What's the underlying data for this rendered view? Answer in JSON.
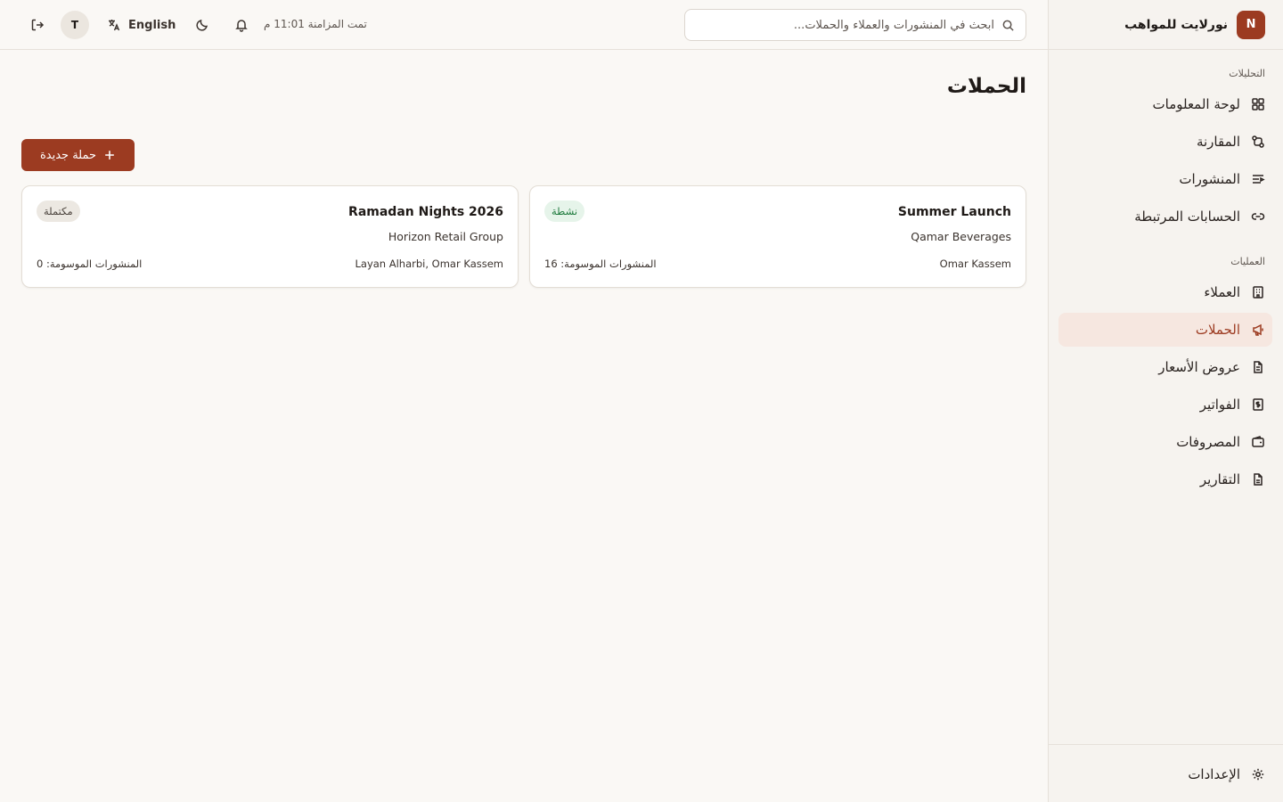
{
  "brand": {
    "initial": "N",
    "name": "نورلايت للمواهب"
  },
  "search": {
    "placeholder": "ابحث في المنشورات والعملاء والحملات..."
  },
  "topbar": {
    "sync_status": "تمت المزامنة 11:01 م",
    "language_label": "English",
    "avatar_initial": "T"
  },
  "sidebar": {
    "analytics_title": "التحليلات",
    "analytics_items": [
      {
        "label": "لوحة المعلومات",
        "icon": "dashboard-icon"
      },
      {
        "label": "المقارنة",
        "icon": "compare-icon"
      },
      {
        "label": "المنشورات",
        "icon": "posts-icon"
      },
      {
        "label": "الحسابات المرتبطة",
        "icon": "link-icon"
      }
    ],
    "operations_title": "العمليات",
    "operations_items": [
      {
        "label": "العملاء",
        "icon": "building-icon"
      },
      {
        "label": "الحملات",
        "icon": "megaphone-icon",
        "active": true
      },
      {
        "label": "عروض الأسعار",
        "icon": "document-icon"
      },
      {
        "label": "الفواتير",
        "icon": "dollar-receipt-icon"
      },
      {
        "label": "المصروفات",
        "icon": "wallet-icon"
      },
      {
        "label": "التقارير",
        "icon": "report-icon"
      }
    ],
    "settings_label": "الإعدادات"
  },
  "main": {
    "title": "الحملات",
    "new_button_label": "حملة جديدة"
  },
  "campaigns": [
    {
      "name": "Summer Launch",
      "client": "Qamar Beverages",
      "people": "Omar Kassem",
      "posts": "المنشورات الموسومة: 16",
      "status": "نشطة",
      "status_type": "active"
    },
    {
      "name": "Ramadan Nights 2026",
      "client": "Horizon Retail Group",
      "people": "Layan Alharbi, Omar Kassem",
      "posts": "المنشورات الموسومة: 0",
      "status": "مكتملة",
      "status_type": "done"
    }
  ],
  "colors": {
    "accent": "#9c3b21",
    "active_badge_bg": "#e6f4ea",
    "active_badge_text": "#1e7a3d",
    "done_badge_bg": "#ece8e2"
  }
}
